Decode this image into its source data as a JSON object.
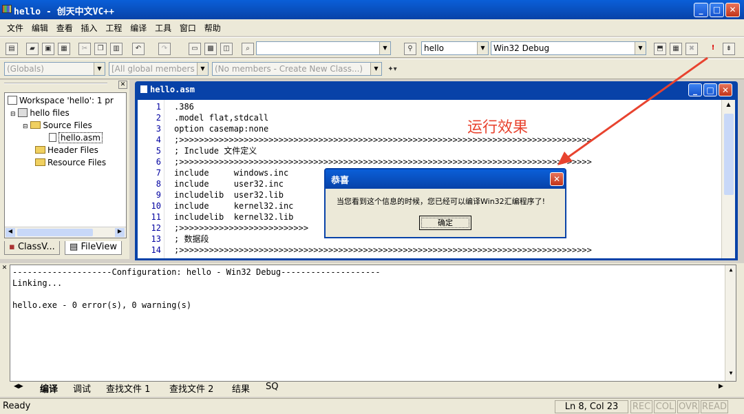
{
  "window": {
    "title": "hello - 创天中文VC++"
  },
  "menu": [
    "文件",
    "编辑",
    "查看",
    "插入",
    "工程",
    "编译",
    "工具",
    "窗口",
    "帮助"
  ],
  "toolbar": {
    "find_value": "",
    "project": "hello",
    "config": "Win32 Debug",
    "globals": "(Globals)",
    "members": "[All global members",
    "no_members": "(No members - Create New Class...)"
  },
  "workspace": {
    "root": "Workspace 'hello': 1 pr",
    "project": "hello files",
    "folders": [
      "Source Files",
      "Header Files",
      "Resource Files"
    ],
    "file": "hello.asm",
    "tabs": [
      "ClassV...",
      "FileView"
    ]
  },
  "editor": {
    "title": "hello.asm",
    "lines": [
      {
        "n": "1",
        "t": ".386"
      },
      {
        "n": "2",
        "t": ".model flat,stdcall"
      },
      {
        "n": "3",
        "t": "option casemap:none"
      },
      {
        "n": "4",
        "t": ";>>>>>>>>>>>>>>>>>>>>>>>>>>>>>>>>>>>>>>>>>>>>>>>>>>>>>>>>>>>>>>>>>>>>>>>>>>>>>>>>>>>"
      },
      {
        "n": "5",
        "t": "; Include 文件定义"
      },
      {
        "n": "6",
        "t": ";>>>>>>>>>>>>>>>>>>>>>>>>>>>>>>>>>>>>>>>>>>>>>>>>>>>>>>>>>>>>>>>>>>>>>>>>>>>>>>>>>>>"
      },
      {
        "n": "7",
        "t": "include     windows.inc"
      },
      {
        "n": "8",
        "t": "include     user32.inc"
      },
      {
        "n": "9",
        "t": "includelib  user32.lib"
      },
      {
        "n": "10",
        "t": "include     kernel32.inc"
      },
      {
        "n": "11",
        "t": "includelib  kernel32.lib"
      },
      {
        "n": "12",
        "t": ";>>>>>>>>>>>>>>>>>>>>>>>>>>"
      },
      {
        "n": "13",
        "t": "; 数据段"
      },
      {
        "n": "14",
        "t": ";>>>>>>>>>>>>>>>>>>>>>>>>>>>>>>>>>>>>>>>>>>>>>>>>>>>>>>>>>>>>>>>>>>>>>>>>>>>>>>>>>>>"
      }
    ]
  },
  "annotation": "运行效果",
  "dialog": {
    "title": "恭喜",
    "message": "当您看到这个信息的时候，您已经可以编译Win32汇编程序了!",
    "ok": "确定"
  },
  "output": {
    "lines": [
      "--------------------Configuration: hello - Win32 Debug--------------------",
      "Linking...",
      "",
      "hello.exe - 0 error(s), 0 warning(s)"
    ],
    "tabs": [
      "编译",
      "调试",
      "查找文件 1",
      "查找文件 2",
      "结果",
      "SQ"
    ]
  },
  "status": {
    "ready": "Ready",
    "pos": "Ln 8, Col 23",
    "indicators": [
      "REC",
      "COL",
      "OVR",
      "READ"
    ]
  },
  "colors": {
    "accent": "#0842a8",
    "annotation": "#e8432f",
    "line_numbers": "#0000a0"
  }
}
